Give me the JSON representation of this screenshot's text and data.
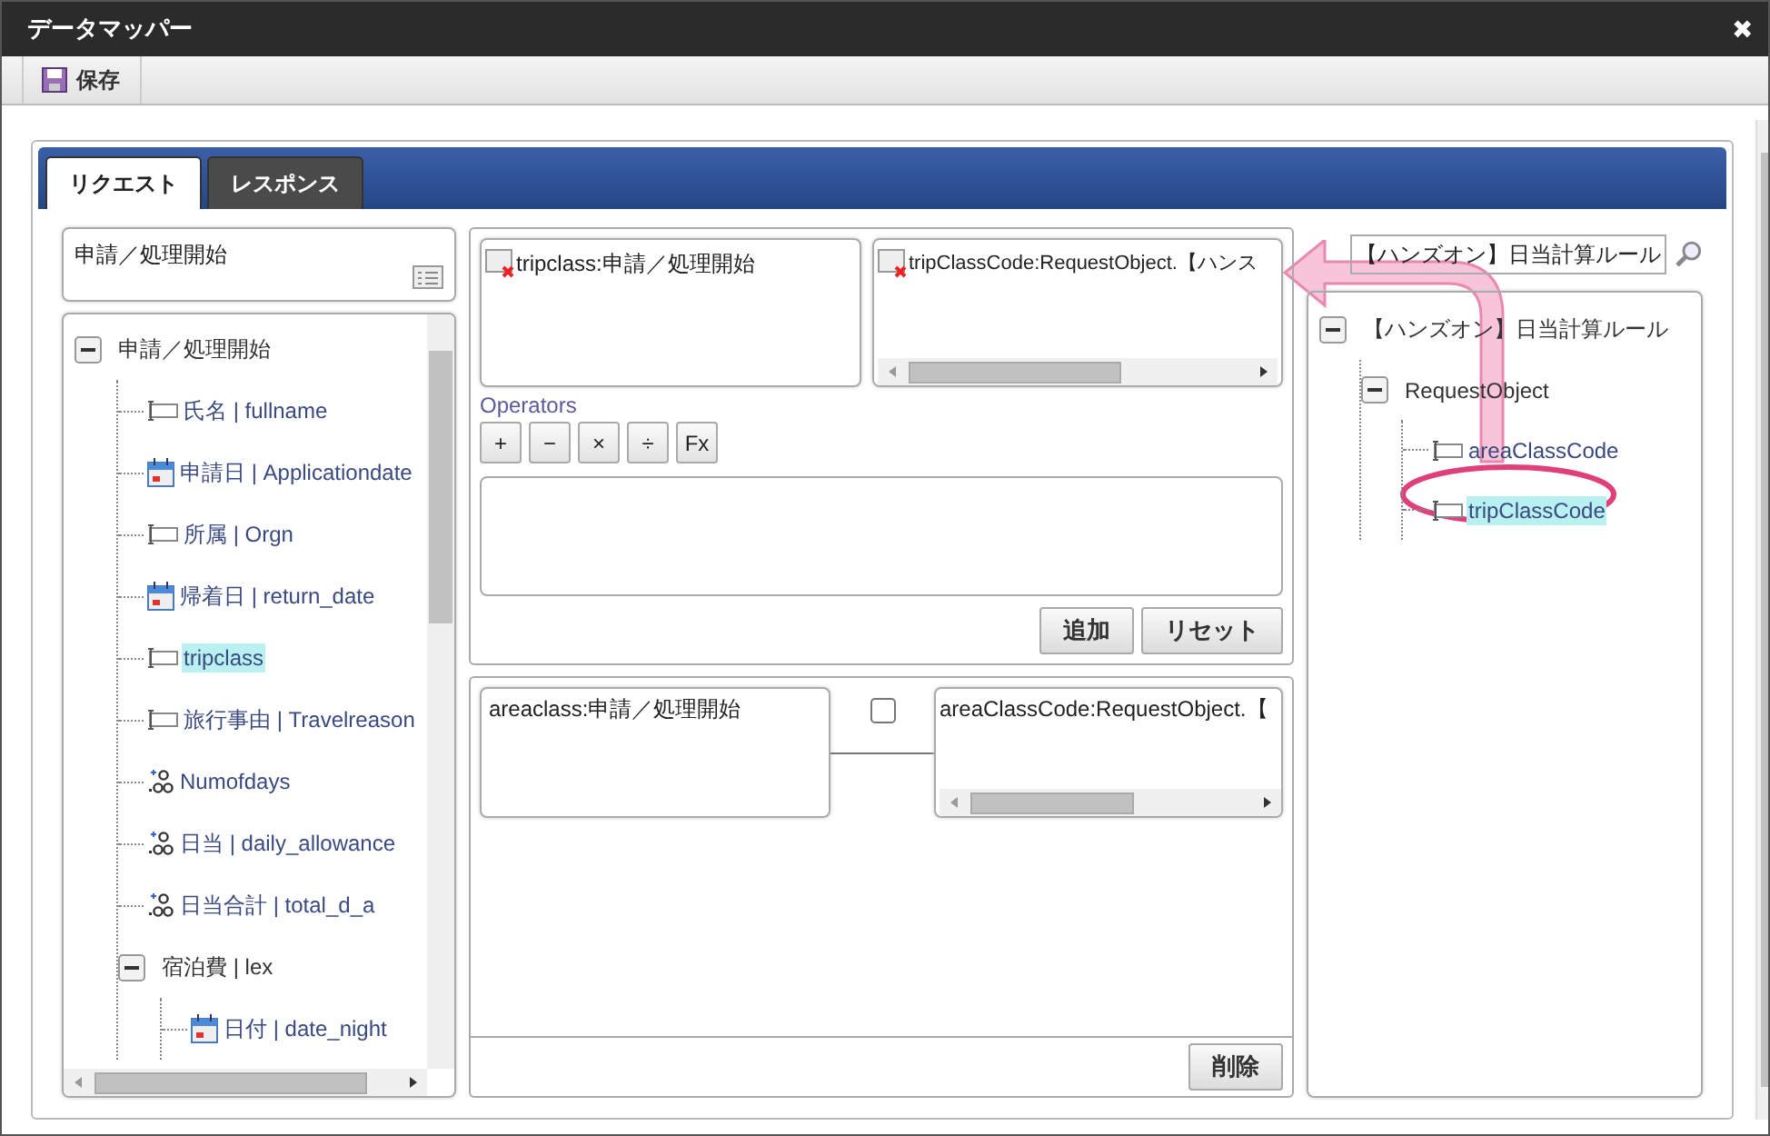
{
  "window": {
    "title": "データマッパー",
    "close": "✖"
  },
  "toolbar": {
    "buttons": [
      {
        "label": "保存"
      }
    ]
  },
  "tabs": [
    {
      "label": "リクエスト",
      "selected": true
    },
    {
      "label": "レスポンス",
      "selected": false
    }
  ],
  "source": {
    "title": "申請／処理開始",
    "tree": [
      {
        "label": "申請／処理開始",
        "kind": "group",
        "expanded": true,
        "selected": false,
        "children": [
          {
            "label": "氏名 | fullname",
            "kind": "text",
            "selected": false
          },
          {
            "label": "申請日 | Applicationdate",
            "kind": "date",
            "selected": false
          },
          {
            "label": "所属 | Orgn",
            "kind": "text",
            "selected": false
          },
          {
            "label": "帰着日 | return_date",
            "kind": "date",
            "selected": false
          },
          {
            "label": "tripclass",
            "kind": "text",
            "selected": true
          },
          {
            "label": "旅行事由 | Travelreason",
            "kind": "text",
            "selected": false
          },
          {
            "label": "Numofdays",
            "kind": "number",
            "selected": false
          },
          {
            "label": "日当 | daily_allowance",
            "kind": "number",
            "selected": false
          },
          {
            "label": "日当合計 | total_d_a",
            "kind": "number",
            "selected": false
          },
          {
            "label": "宿泊費 | lex",
            "kind": "group",
            "expanded": true,
            "selected": false,
            "children": [
              {
                "label": "日付 | date_night",
                "kind": "date",
                "selected": false
              }
            ]
          }
        ]
      }
    ]
  },
  "editor": {
    "source_field": "tripclass:申請／処理開始",
    "target_field": "tripClassCode:RequestObject.【ハンス",
    "operators_label": "Operators",
    "operators": [
      "+",
      "−",
      "×",
      "÷",
      "Fx"
    ],
    "buttons": [
      "追加",
      "リセット"
    ]
  },
  "mappings": {
    "rows": [
      {
        "source": "areaclass:申請／処理開始",
        "target": "areaClassCode:RequestObject.【",
        "checked": false
      }
    ],
    "buttons": [
      "削除"
    ]
  },
  "target": {
    "search": {
      "value": "【ハンズオン】日当計算ルール"
    },
    "tree": [
      {
        "label": "【ハンズオン】日当計算ルール",
        "kind": "group",
        "expanded": true,
        "selected": false,
        "children": [
          {
            "label": "RequestObject",
            "kind": "group",
            "expanded": true,
            "selected": false,
            "children": [
              {
                "label": "areaClassCode",
                "kind": "text",
                "selected": false
              },
              {
                "label": "tripClassCode",
                "kind": "text",
                "selected": true
              }
            ]
          }
        ]
      }
    ]
  }
}
